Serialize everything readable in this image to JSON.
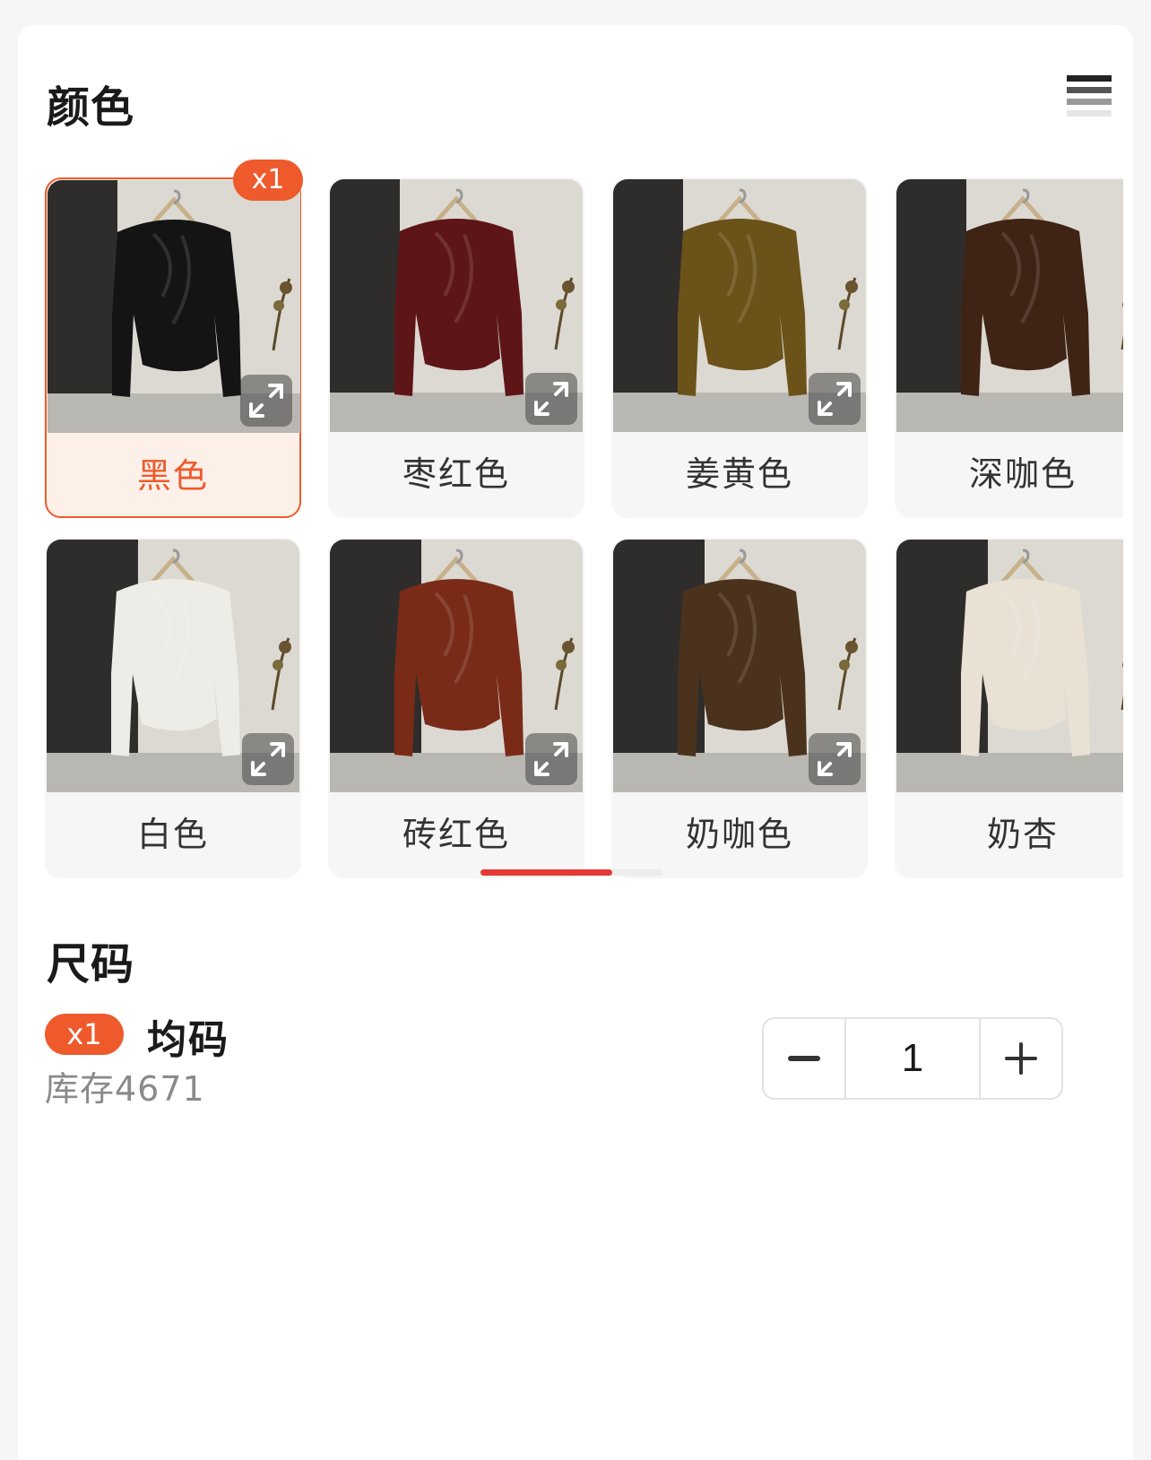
{
  "color_section": {
    "title": "颜色",
    "selected_count_badge": "x1",
    "options": [
      {
        "label": "黑色",
        "selected": true,
        "garment_color": "#141414"
      },
      {
        "label": "枣红色",
        "selected": false,
        "garment_color": "#5e1518"
      },
      {
        "label": "姜黄色",
        "selected": false,
        "garment_color": "#6b5219"
      },
      {
        "label": "深咖色",
        "selected": false,
        "garment_color": "#3f2315"
      },
      {
        "label": "白色",
        "selected": false,
        "garment_color": "#eeece6"
      },
      {
        "label": "砖红色",
        "selected": false,
        "garment_color": "#7a2b17"
      },
      {
        "label": "奶咖色",
        "selected": false,
        "garment_color": "#4a321c"
      },
      {
        "label": "奶杏",
        "selected": false,
        "garment_color": "#e8e1d4"
      }
    ],
    "scroll_progress": 0.72
  },
  "size_section": {
    "title": "尺码",
    "selected_count_badge": "x1",
    "size_name": "均码",
    "stock": "库存4671",
    "quantity": "1"
  },
  "colors": {
    "accent": "#ee5a2c",
    "scroll_thumb": "#e53935"
  },
  "icons": {
    "expand": "expand-arrows-icon",
    "minus": "minus-icon",
    "plus": "plus-icon",
    "view_toggle": "list-view-icon"
  }
}
